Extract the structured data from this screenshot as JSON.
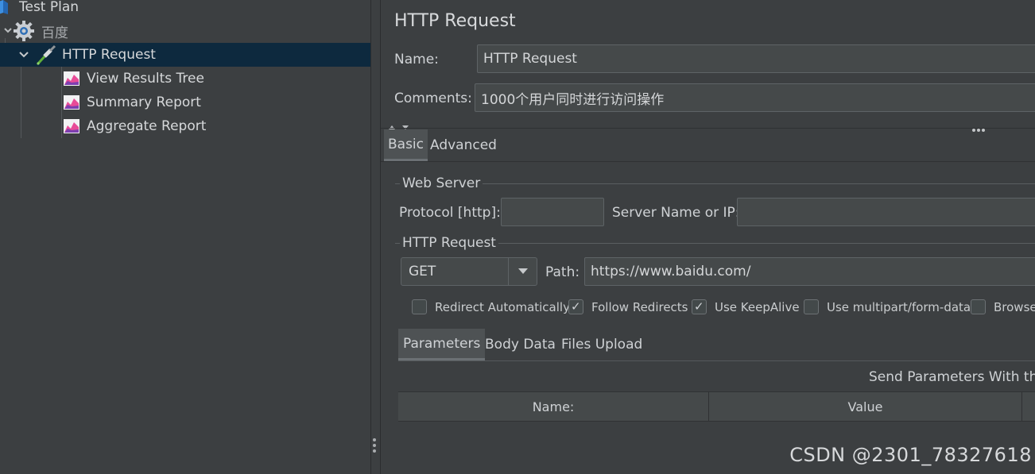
{
  "tree": {
    "items": [
      {
        "label": "Test Plan",
        "icon": "test-plan-icon"
      },
      {
        "label": "百度",
        "icon": "gear-icon"
      },
      {
        "label": "HTTP Request",
        "icon": "pipette-sampler-icon"
      },
      {
        "label": "View Results Tree",
        "icon": "listener-chart-icon"
      },
      {
        "label": "Summary Report",
        "icon": "listener-chart-icon"
      },
      {
        "label": "Aggregate Report",
        "icon": "listener-chart-icon"
      }
    ]
  },
  "panel": {
    "title": "HTTP Request",
    "name_label": "Name:",
    "name_value": "HTTP Request",
    "comments_label": "Comments:",
    "comments_value": "1000个用户同时进行访问操作",
    "tabs": [
      "Basic",
      "Advanced"
    ],
    "web_server": {
      "group_title": "Web Server",
      "protocol_label": "Protocol [http]:",
      "protocol_value": "",
      "server_label": "Server Name or IP:",
      "server_value": ""
    },
    "http_request": {
      "group_title": "HTTP Request",
      "method": "GET",
      "path_label": "Path:",
      "path_value": "https://www.baidu.com/"
    },
    "checkboxes": [
      {
        "label": "Redirect Automatically",
        "checked": false
      },
      {
        "label": "Follow Redirects",
        "checked": true
      },
      {
        "label": "Use KeepAlive",
        "checked": true
      },
      {
        "label": "Use multipart/form-data",
        "checked": false
      },
      {
        "label": "Browser",
        "checked": false
      }
    ],
    "param_tabs": [
      "Parameters",
      "Body Data",
      "Files Upload"
    ],
    "send_params_text": "Send Parameters With the",
    "table_headers": [
      "Name:",
      "Value"
    ]
  },
  "watermark": "CSDN @2301_78327618",
  "colors": {
    "background": "#3c3f41",
    "selected_row": "#0d293e",
    "field_bg": "#45494a"
  }
}
